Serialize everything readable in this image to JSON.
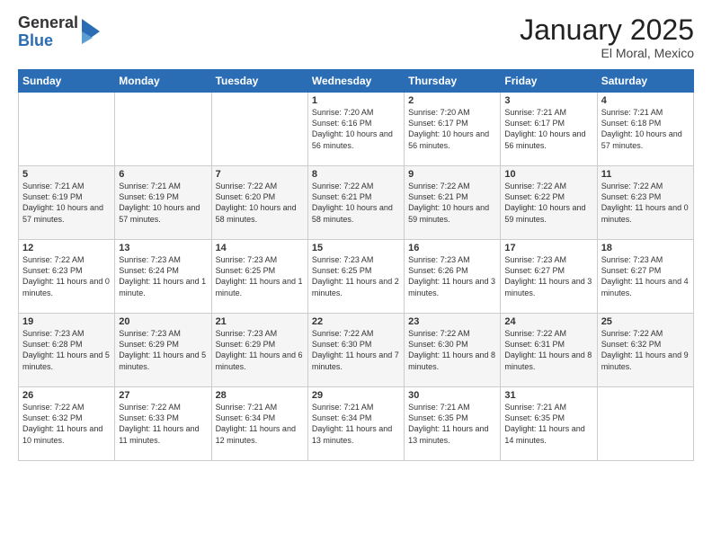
{
  "logo": {
    "general": "General",
    "blue": "Blue"
  },
  "header": {
    "month": "January 2025",
    "location": "El Moral, Mexico"
  },
  "weekdays": [
    "Sunday",
    "Monday",
    "Tuesday",
    "Wednesday",
    "Thursday",
    "Friday",
    "Saturday"
  ],
  "weeks": [
    [
      {
        "day": "",
        "info": ""
      },
      {
        "day": "",
        "info": ""
      },
      {
        "day": "",
        "info": ""
      },
      {
        "day": "1",
        "info": "Sunrise: 7:20 AM\nSunset: 6:16 PM\nDaylight: 10 hours and 56 minutes."
      },
      {
        "day": "2",
        "info": "Sunrise: 7:20 AM\nSunset: 6:17 PM\nDaylight: 10 hours and 56 minutes."
      },
      {
        "day": "3",
        "info": "Sunrise: 7:21 AM\nSunset: 6:17 PM\nDaylight: 10 hours and 56 minutes."
      },
      {
        "day": "4",
        "info": "Sunrise: 7:21 AM\nSunset: 6:18 PM\nDaylight: 10 hours and 57 minutes."
      }
    ],
    [
      {
        "day": "5",
        "info": "Sunrise: 7:21 AM\nSunset: 6:19 PM\nDaylight: 10 hours and 57 minutes."
      },
      {
        "day": "6",
        "info": "Sunrise: 7:21 AM\nSunset: 6:19 PM\nDaylight: 10 hours and 57 minutes."
      },
      {
        "day": "7",
        "info": "Sunrise: 7:22 AM\nSunset: 6:20 PM\nDaylight: 10 hours and 58 minutes."
      },
      {
        "day": "8",
        "info": "Sunrise: 7:22 AM\nSunset: 6:21 PM\nDaylight: 10 hours and 58 minutes."
      },
      {
        "day": "9",
        "info": "Sunrise: 7:22 AM\nSunset: 6:21 PM\nDaylight: 10 hours and 59 minutes."
      },
      {
        "day": "10",
        "info": "Sunrise: 7:22 AM\nSunset: 6:22 PM\nDaylight: 10 hours and 59 minutes."
      },
      {
        "day": "11",
        "info": "Sunrise: 7:22 AM\nSunset: 6:23 PM\nDaylight: 11 hours and 0 minutes."
      }
    ],
    [
      {
        "day": "12",
        "info": "Sunrise: 7:22 AM\nSunset: 6:23 PM\nDaylight: 11 hours and 0 minutes."
      },
      {
        "day": "13",
        "info": "Sunrise: 7:23 AM\nSunset: 6:24 PM\nDaylight: 11 hours and 1 minute."
      },
      {
        "day": "14",
        "info": "Sunrise: 7:23 AM\nSunset: 6:25 PM\nDaylight: 11 hours and 1 minute."
      },
      {
        "day": "15",
        "info": "Sunrise: 7:23 AM\nSunset: 6:25 PM\nDaylight: 11 hours and 2 minutes."
      },
      {
        "day": "16",
        "info": "Sunrise: 7:23 AM\nSunset: 6:26 PM\nDaylight: 11 hours and 3 minutes."
      },
      {
        "day": "17",
        "info": "Sunrise: 7:23 AM\nSunset: 6:27 PM\nDaylight: 11 hours and 3 minutes."
      },
      {
        "day": "18",
        "info": "Sunrise: 7:23 AM\nSunset: 6:27 PM\nDaylight: 11 hours and 4 minutes."
      }
    ],
    [
      {
        "day": "19",
        "info": "Sunrise: 7:23 AM\nSunset: 6:28 PM\nDaylight: 11 hours and 5 minutes."
      },
      {
        "day": "20",
        "info": "Sunrise: 7:23 AM\nSunset: 6:29 PM\nDaylight: 11 hours and 5 minutes."
      },
      {
        "day": "21",
        "info": "Sunrise: 7:23 AM\nSunset: 6:29 PM\nDaylight: 11 hours and 6 minutes."
      },
      {
        "day": "22",
        "info": "Sunrise: 7:22 AM\nSunset: 6:30 PM\nDaylight: 11 hours and 7 minutes."
      },
      {
        "day": "23",
        "info": "Sunrise: 7:22 AM\nSunset: 6:30 PM\nDaylight: 11 hours and 8 minutes."
      },
      {
        "day": "24",
        "info": "Sunrise: 7:22 AM\nSunset: 6:31 PM\nDaylight: 11 hours and 8 minutes."
      },
      {
        "day": "25",
        "info": "Sunrise: 7:22 AM\nSunset: 6:32 PM\nDaylight: 11 hours and 9 minutes."
      }
    ],
    [
      {
        "day": "26",
        "info": "Sunrise: 7:22 AM\nSunset: 6:32 PM\nDaylight: 11 hours and 10 minutes."
      },
      {
        "day": "27",
        "info": "Sunrise: 7:22 AM\nSunset: 6:33 PM\nDaylight: 11 hours and 11 minutes."
      },
      {
        "day": "28",
        "info": "Sunrise: 7:21 AM\nSunset: 6:34 PM\nDaylight: 11 hours and 12 minutes."
      },
      {
        "day": "29",
        "info": "Sunrise: 7:21 AM\nSunset: 6:34 PM\nDaylight: 11 hours and 13 minutes."
      },
      {
        "day": "30",
        "info": "Sunrise: 7:21 AM\nSunset: 6:35 PM\nDaylight: 11 hours and 13 minutes."
      },
      {
        "day": "31",
        "info": "Sunrise: 7:21 AM\nSunset: 6:35 PM\nDaylight: 11 hours and 14 minutes."
      },
      {
        "day": "",
        "info": ""
      }
    ]
  ]
}
